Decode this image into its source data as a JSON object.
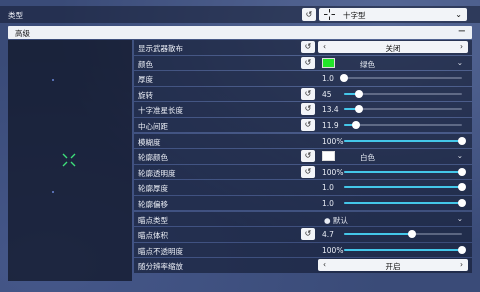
{
  "type_row": {
    "label": "类型",
    "reset_icon": "↺",
    "value": "十字型",
    "chevron": "⌄"
  },
  "section": {
    "title": "高级",
    "collapse_icon": "−"
  },
  "accent_color": "#44c7e9",
  "crosshair_color": "#3ee07a",
  "rows": [
    {
      "key": "show_weapon_spread",
      "label": "显示武器散布",
      "reset": true,
      "control": "arrows",
      "value": "关闭"
    },
    {
      "key": "color",
      "label": "颜色",
      "reset": true,
      "control": "color",
      "value": "绿色",
      "swatch": "#22e52a"
    },
    {
      "key": "thickness",
      "label": "厚度",
      "reset": false,
      "control": "slider",
      "value": "1.0",
      "fraction": 0.0
    },
    {
      "key": "rotation",
      "label": "旋转",
      "reset": true,
      "control": "slider",
      "value": "45",
      "fraction": 0.125
    },
    {
      "key": "cross_length",
      "label": "十字准星长度",
      "reset": true,
      "control": "slider",
      "value": "13.4",
      "fraction": 0.13
    },
    {
      "key": "center_gap",
      "label": "中心间距",
      "reset": true,
      "control": "slider",
      "value": "11.9",
      "fraction": 0.1
    },
    {
      "key": "opacity",
      "label": "模糊度",
      "reset": false,
      "control": "slider",
      "value": "100%",
      "fraction": 1.0
    },
    {
      "key": "outline_color",
      "label": "轮廓颜色",
      "reset": true,
      "control": "color",
      "value": "白色",
      "swatch": "#ffffff"
    },
    {
      "key": "outline_opacity",
      "label": "轮廓透明度",
      "reset": true,
      "control": "slider",
      "value": "100%",
      "fraction": 1.0
    },
    {
      "key": "outline_thickness",
      "label": "轮廓厚度",
      "reset": false,
      "control": "slider",
      "value": "1.0",
      "fraction": 1.0
    },
    {
      "key": "outline_offset",
      "label": "轮廓偏移",
      "reset": false,
      "control": "slider",
      "value": "1.0",
      "fraction": 1.0
    },
    {
      "key": "dot_type",
      "label": "瞄点类型",
      "reset": false,
      "control": "dropdown",
      "value": "● 默认"
    },
    {
      "key": "dot_size",
      "label": "瞄点体积",
      "reset": true,
      "control": "slider",
      "value": "4.7",
      "fraction": 0.58
    },
    {
      "key": "dot_opacity",
      "label": "瞄点不透明度",
      "reset": false,
      "control": "slider",
      "value": "100%",
      "fraction": 1.0
    },
    {
      "key": "resolution_scaling",
      "label": "随分辨率缩放",
      "reset": false,
      "control": "arrows",
      "value": "开启"
    }
  ]
}
